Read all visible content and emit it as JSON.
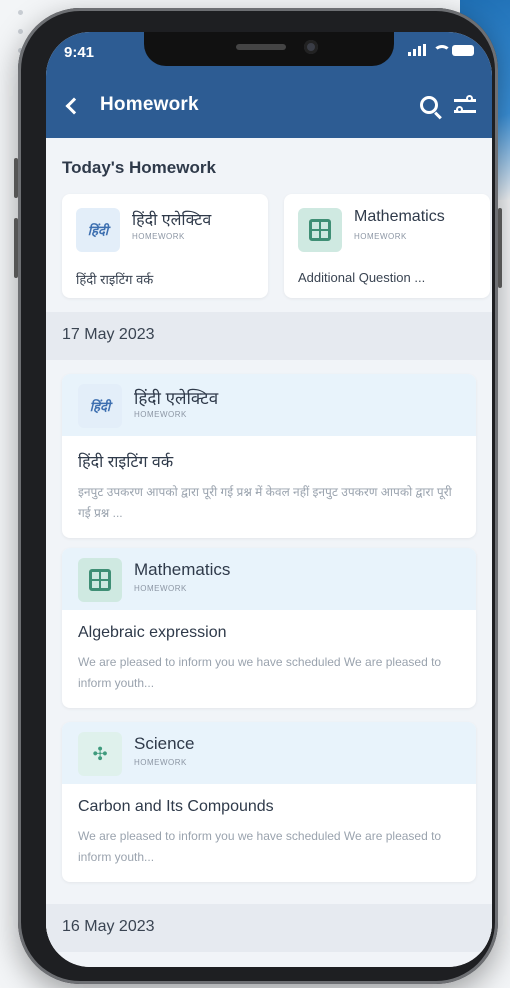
{
  "status_bar": {
    "time": "9:41"
  },
  "header": {
    "title": "Homework"
  },
  "today": {
    "heading": "Today's Homework",
    "cards": [
      {
        "subject": "हिंदी एलेक्टिव",
        "type": "HOMEWORK",
        "title": "हिंदी राइटिंग वर्क",
        "icon": "hindi-icon",
        "icon_text": "हिंदी"
      },
      {
        "subject": "Mathematics",
        "type": "HOMEWORK",
        "title": "Additional Question ...",
        "icon": "math-icon"
      }
    ]
  },
  "groups": [
    {
      "date": "17 May 2023",
      "items": [
        {
          "subject": "हिंदी एलेक्टिव",
          "type": "HOMEWORK",
          "icon": "hindi-icon",
          "icon_text": "हिंदी",
          "title": "हिंदी राइटिंग वर्क",
          "desc": "इनपुट उपकरण आपको द्वारा पूरी गई प्रश्न में केवल नहीं इनपुट उपकरण आपको द्वारा पूरी गई प्रश्न ..."
        },
        {
          "subject": "Mathematics",
          "type": "HOMEWORK",
          "icon": "math-icon",
          "title": "Algebraic expression",
          "desc": "We are pleased to inform you we have scheduled We are pleased to inform youth..."
        },
        {
          "subject": "Science",
          "type": "HOMEWORK",
          "icon": "science-icon",
          "icon_text": "✣",
          "title": "Carbon and Its Compounds",
          "desc": "We are pleased to inform you we have scheduled We are pleased to inform youth..."
        }
      ]
    },
    {
      "date": "16 May 2023",
      "items": []
    }
  ],
  "colors": {
    "header_bg": "#2d5c93",
    "card_head_bg": "#e8f3fb",
    "math_icon_bg": "#cfe9e1"
  }
}
